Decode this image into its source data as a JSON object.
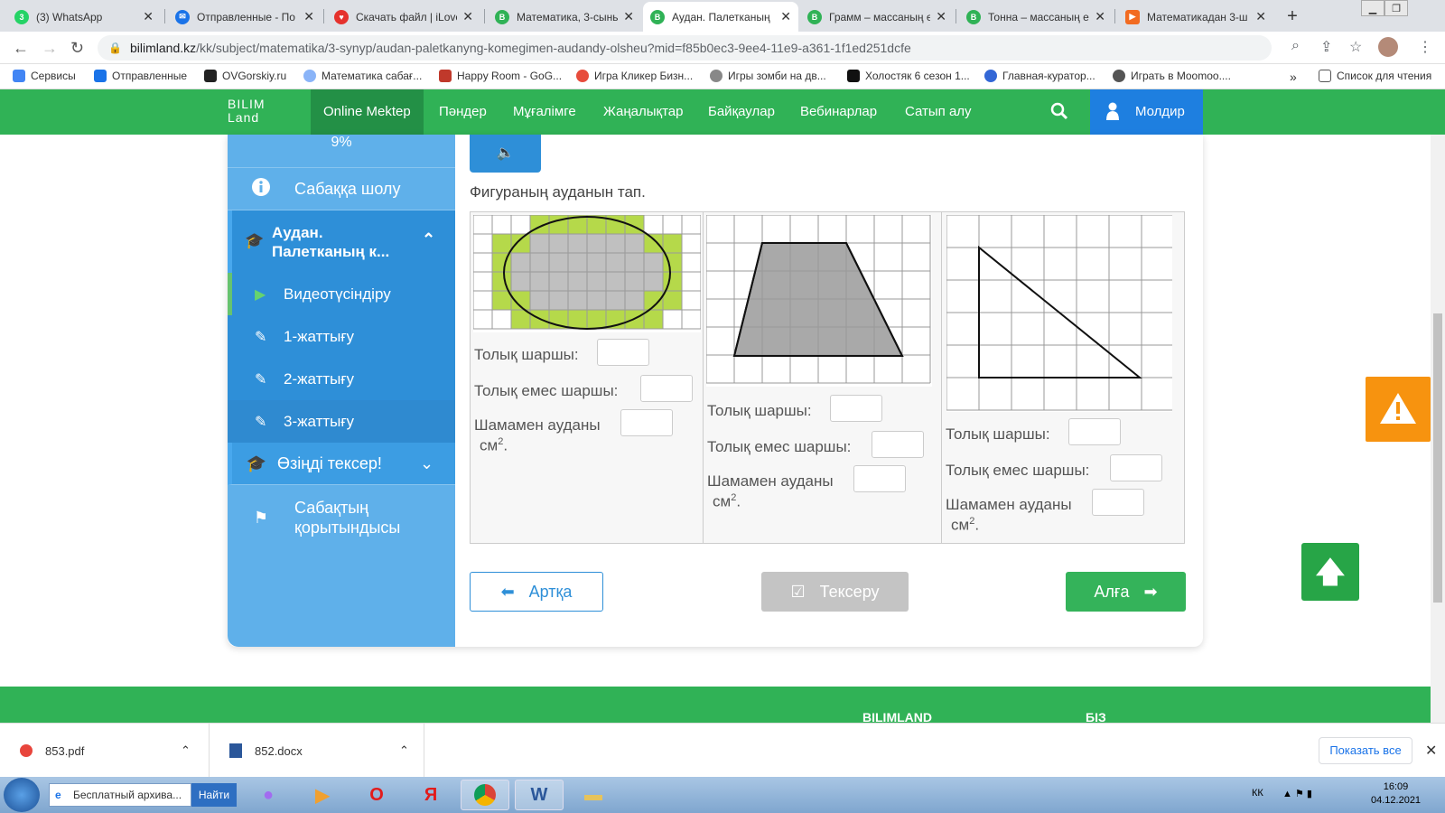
{
  "browser": {
    "tabs": [
      {
        "title": "(3) WhatsApp",
        "color": "#25d366",
        "glyph": "3"
      },
      {
        "title": "Отправленные - По",
        "color": "#1a73e8",
        "glyph": "✉"
      },
      {
        "title": "Скачать файл | iLove",
        "color": "#e5322d",
        "glyph": "♥"
      },
      {
        "title": "Математика, 3-сынь",
        "color": "#30b256",
        "glyph": "B"
      },
      {
        "title": "Аудан. Палетканың",
        "color": "#30b256",
        "glyph": "B"
      },
      {
        "title": "Грамм – массаның е",
        "color": "#30b256",
        "glyph": "B"
      },
      {
        "title": "Тонна – массаның е",
        "color": "#30b256",
        "glyph": "B"
      },
      {
        "title": "Математикадан 3-ш",
        "color": "#f26b21",
        "glyph": "▶"
      }
    ],
    "url_host": "bilimland.kz",
    "url_path": "/kk/subject/matematika/3-synyp/audan-paletkanyng-komegimen-audandy-olsheu?mid=f85b0ec3-9ee4-11e9-a361-1f1ed251dcfe",
    "bookmarks": [
      {
        "label": "Сервисы",
        "color": "#4285f4"
      },
      {
        "label": "Отправленные",
        "color": "#1a73e8"
      },
      {
        "label": "OVGorskiy.ru",
        "color": "#222222"
      },
      {
        "label": "Математика сабағ...",
        "color": "#8ab4f8"
      },
      {
        "label": "Happy Room - GoG...",
        "color": "#c0392b"
      },
      {
        "label": "Игра Кликер Бизн...",
        "color": "#e74c3c"
      },
      {
        "label": "Игры зомби на дв...",
        "color": "#888888"
      },
      {
        "label": "Холостяк 6 сезон 1...",
        "color": "#111111"
      },
      {
        "label": "Главная-куратор...",
        "color": "#3367d6"
      },
      {
        "label": "Играть в Moomoo....",
        "color": "#555555"
      }
    ],
    "bookmarks_more": "»",
    "reading_list": "Список для чтения"
  },
  "site": {
    "logo_line1": "BILIM",
    "logo_line2": "Land",
    "nav": [
      "Online Mektep",
      "Пәндер",
      "Мұғалімге",
      "Жаңалықтар",
      "Байқаулар",
      "Вебинарлар",
      "Сатып алу"
    ],
    "user": "Молдир"
  },
  "sidebar": {
    "progress": "9%",
    "overview": "Сабаққа шолу",
    "open_section": "Аудан. Палетканың к...",
    "subitems": [
      "Видеотүсіндіру",
      "1-жаттығу",
      "2-жаттығу",
      "3-жаттығу"
    ],
    "check_yourself": "Өзіңді тексер!",
    "summary": "Сабақтың қорытындысы"
  },
  "exercise": {
    "question": "Фигураның ауданын тап.",
    "label_full": "Толық шаршы:",
    "label_partial": "Толық емес шаршы:",
    "label_area": "Шамамен ауданы",
    "unit": "см",
    "unit_exp": "2",
    "unit_dot": "."
  },
  "buttons": {
    "back": "Артқа",
    "check": "Тексеру",
    "next": "Алға"
  },
  "footer": {
    "col1": "BILIMLAND",
    "col2": "БІЗ"
  },
  "downloads": [
    {
      "name": "853.pdf"
    },
    {
      "name": "852.docx"
    }
  ],
  "downloads_show_all": "Показать все",
  "taskbar": {
    "ie_title": "Бесплатный архива...",
    "search_btn": "Найти",
    "lang": "КК",
    "time": "16:09",
    "date": "04.12.2021"
  },
  "colors": {
    "green": "#30b256",
    "blue": "#2e8fd8",
    "sidebar": "#5fb0ea",
    "orange": "#f7930f"
  }
}
